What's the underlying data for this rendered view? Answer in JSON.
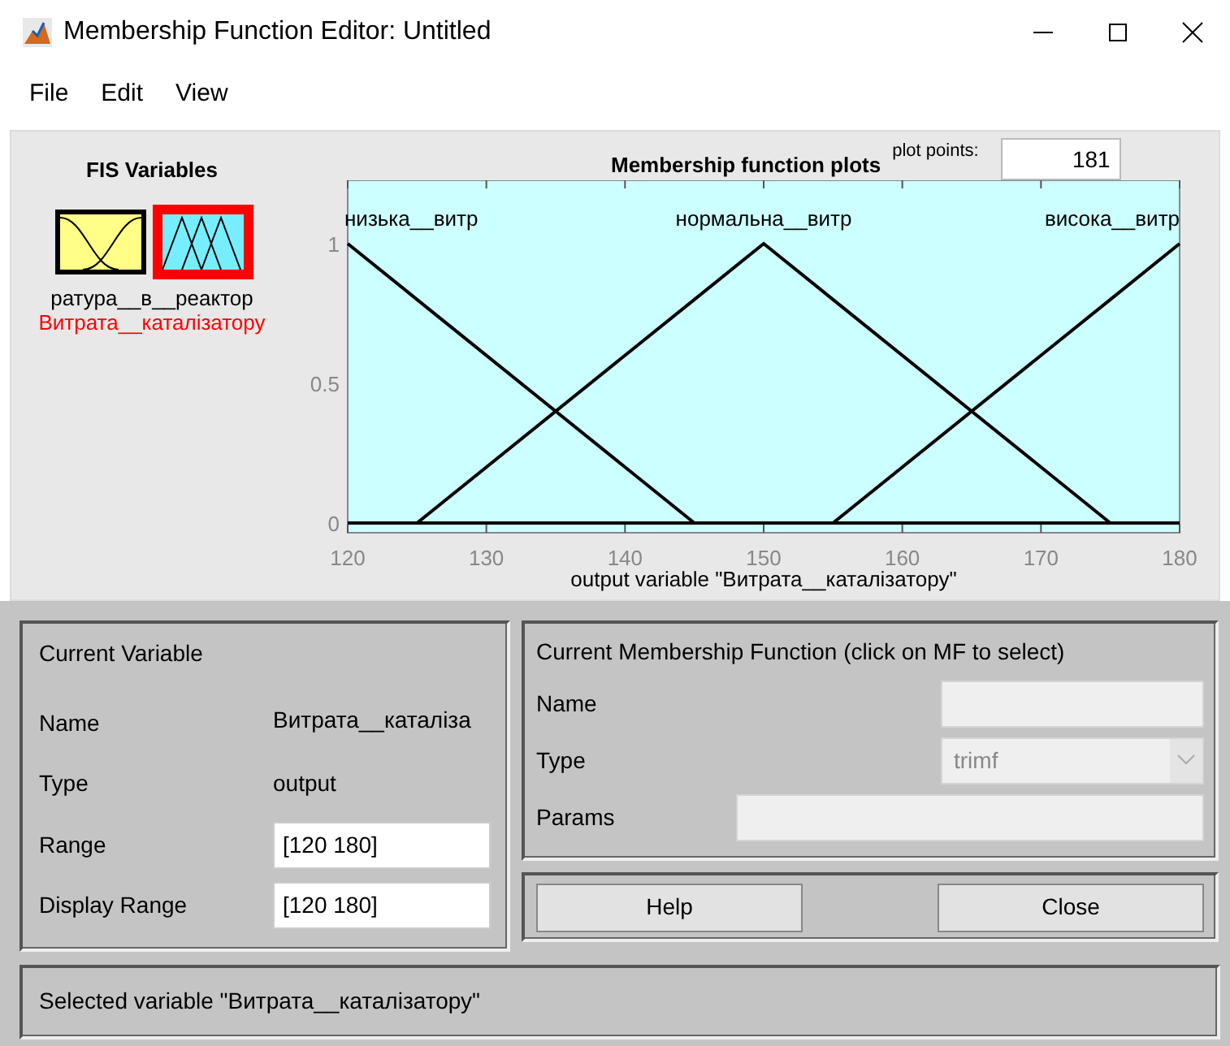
{
  "window": {
    "title": "Membership Function Editor: Untitled"
  },
  "menu": [
    "File",
    "Edit",
    "View"
  ],
  "fis_variables": {
    "title": "FIS Variables",
    "items": [
      {
        "label": "ратура__в__реактор",
        "kind": "input",
        "selected": false
      },
      {
        "label": "Витрата__каталізатору",
        "kind": "output",
        "selected": true
      }
    ]
  },
  "plot": {
    "title": "Membership function plots",
    "plot_points_label": "plot points:",
    "plot_points": "181",
    "chart_data": {
      "type": "line",
      "xlabel": "output variable \"Витрата__каталізатору\"",
      "x": [
        120,
        125,
        145,
        150,
        155,
        175,
        180
      ],
      "series": [
        {
          "name": "низька__витр",
          "color": "#000000",
          "values": [
            1,
            0.8,
            0,
            0,
            0,
            0,
            0
          ]
        },
        {
          "name": "нормальна__витр",
          "color": "#000000",
          "values": [
            0,
            0,
            0.8,
            1,
            0.8,
            0,
            0
          ]
        },
        {
          "name": "висока__витр",
          "color": "#000000",
          "values": [
            0,
            0,
            0,
            0,
            0,
            0.8,
            1
          ]
        }
      ],
      "xlim": [
        120,
        180
      ],
      "ylim": [
        -0.035,
        1.227
      ],
      "xticks": [
        120,
        130,
        140,
        150,
        160,
        170,
        180
      ],
      "yticks": [
        {
          "value": 0,
          "label": "0"
        },
        {
          "value": 0.5,
          "label": "0.5"
        },
        {
          "value": 1,
          "label": "1"
        }
      ]
    }
  },
  "current_variable": {
    "title": "Current Variable",
    "name_label": "Name",
    "name": "Витрата__каталіза",
    "type_label": "Type",
    "type": "output",
    "range_label": "Range",
    "range": "[120 180]",
    "display_range_label": "Display Range",
    "display_range": "[120 180]"
  },
  "current_mf": {
    "title": "Current Membership Function (click on MF to select)",
    "name_label": "Name",
    "type_label": "Type",
    "type": "trimf",
    "type_disabled": true,
    "params_label": "Params"
  },
  "buttons": [
    "Help",
    "Close"
  ],
  "status_bar": "Selected variable \"Витрата__каталізатору\""
}
